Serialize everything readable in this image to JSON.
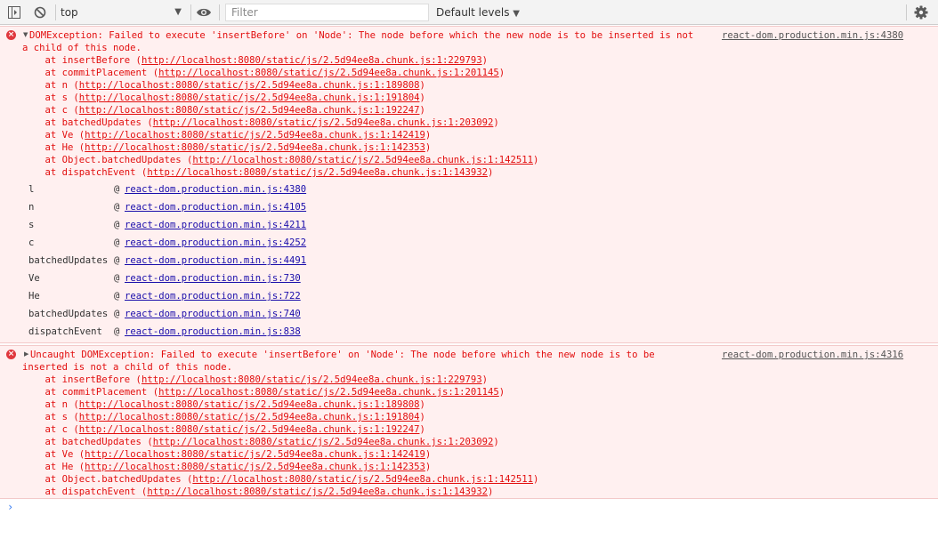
{
  "toolbar": {
    "context": "top",
    "filter_placeholder": "Filter",
    "levels": "Default levels",
    "icons": [
      "sidebar-toggle-icon",
      "clear-console-icon",
      "eye-icon",
      "gear-icon"
    ]
  },
  "errors": [
    {
      "expanded": true,
      "message_lines": [
        "DOMException: Failed to execute 'insertBefore' on 'Node': The node before which the new node is to be inserted is not",
        "a child of this node."
      ],
      "source": "react-dom.production.min.js:4380",
      "stack": [
        {
          "prefix": "    at insertBefore (",
          "url": "http://localhost:8080/static/js/2.5d94ee8a.chunk.js:1:229793",
          "suffix": ")"
        },
        {
          "prefix": "    at commitPlacement (",
          "url": "http://localhost:8080/static/js/2.5d94ee8a.chunk.js:1:201145",
          "suffix": ")"
        },
        {
          "prefix": "    at n (",
          "url": "http://localhost:8080/static/js/2.5d94ee8a.chunk.js:1:189808",
          "suffix": ")"
        },
        {
          "prefix": "    at s (",
          "url": "http://localhost:8080/static/js/2.5d94ee8a.chunk.js:1:191804",
          "suffix": ")"
        },
        {
          "prefix": "    at c (",
          "url": "http://localhost:8080/static/js/2.5d94ee8a.chunk.js:1:192247",
          "suffix": ")"
        },
        {
          "prefix": "    at batchedUpdates (",
          "url": "http://localhost:8080/static/js/2.5d94ee8a.chunk.js:1:203092",
          "suffix": ")"
        },
        {
          "prefix": "    at Ve (",
          "url": "http://localhost:8080/static/js/2.5d94ee8a.chunk.js:1:142419",
          "suffix": ")"
        },
        {
          "prefix": "    at He (",
          "url": "http://localhost:8080/static/js/2.5d94ee8a.chunk.js:1:142353",
          "suffix": ")"
        },
        {
          "prefix": "    at Object.batchedUpdates (",
          "url": "http://localhost:8080/static/js/2.5d94ee8a.chunk.js:1:142511",
          "suffix": ")"
        },
        {
          "prefix": "    at dispatchEvent (",
          "url": "http://localhost:8080/static/js/2.5d94ee8a.chunk.js:1:143932",
          "suffix": ")"
        }
      ],
      "frames": [
        {
          "fn": "l",
          "at": "@",
          "file": "react-dom.production.min.js:4380"
        },
        {
          "fn": "n",
          "at": "@",
          "file": "react-dom.production.min.js:4105"
        },
        {
          "fn": "s",
          "at": "@",
          "file": "react-dom.production.min.js:4211"
        },
        {
          "fn": "c",
          "at": "@",
          "file": "react-dom.production.min.js:4252"
        },
        {
          "fn": "batchedUpdates",
          "at": "@",
          "file": "react-dom.production.min.js:4491"
        },
        {
          "fn": "Ve",
          "at": "@",
          "file": "react-dom.production.min.js:730"
        },
        {
          "fn": "He",
          "at": "@",
          "file": "react-dom.production.min.js:722"
        },
        {
          "fn": "batchedUpdates",
          "at": "@",
          "file": "react-dom.production.min.js:740"
        },
        {
          "fn": "dispatchEvent",
          "at": "@",
          "file": "react-dom.production.min.js:838"
        }
      ]
    },
    {
      "expanded": false,
      "message_lines": [
        "Uncaught DOMException: Failed to execute 'insertBefore' on 'Node': The node before which the new node is to be",
        "inserted is not a child of this node."
      ],
      "source": "react-dom.production.min.js:4316",
      "stack": [
        {
          "prefix": "    at insertBefore (",
          "url": "http://localhost:8080/static/js/2.5d94ee8a.chunk.js:1:229793",
          "suffix": ")"
        },
        {
          "prefix": "    at commitPlacement (",
          "url": "http://localhost:8080/static/js/2.5d94ee8a.chunk.js:1:201145",
          "suffix": ")"
        },
        {
          "prefix": "    at n (",
          "url": "http://localhost:8080/static/js/2.5d94ee8a.chunk.js:1:189808",
          "suffix": ")"
        },
        {
          "prefix": "    at s (",
          "url": "http://localhost:8080/static/js/2.5d94ee8a.chunk.js:1:191804",
          "suffix": ")"
        },
        {
          "prefix": "    at c (",
          "url": "http://localhost:8080/static/js/2.5d94ee8a.chunk.js:1:192247",
          "suffix": ")"
        },
        {
          "prefix": "    at batchedUpdates (",
          "url": "http://localhost:8080/static/js/2.5d94ee8a.chunk.js:1:203092",
          "suffix": ")"
        },
        {
          "prefix": "    at Ve (",
          "url": "http://localhost:8080/static/js/2.5d94ee8a.chunk.js:1:142419",
          "suffix": ")"
        },
        {
          "prefix": "    at He (",
          "url": "http://localhost:8080/static/js/2.5d94ee8a.chunk.js:1:142353",
          "suffix": ")"
        },
        {
          "prefix": "    at Object.batchedUpdates (",
          "url": "http://localhost:8080/static/js/2.5d94ee8a.chunk.js:1:142511",
          "suffix": ")"
        },
        {
          "prefix": "    at dispatchEvent (",
          "url": "http://localhost:8080/static/js/2.5d94ee8a.chunk.js:1:143932",
          "suffix": ")"
        }
      ]
    }
  ],
  "prompt": "›"
}
